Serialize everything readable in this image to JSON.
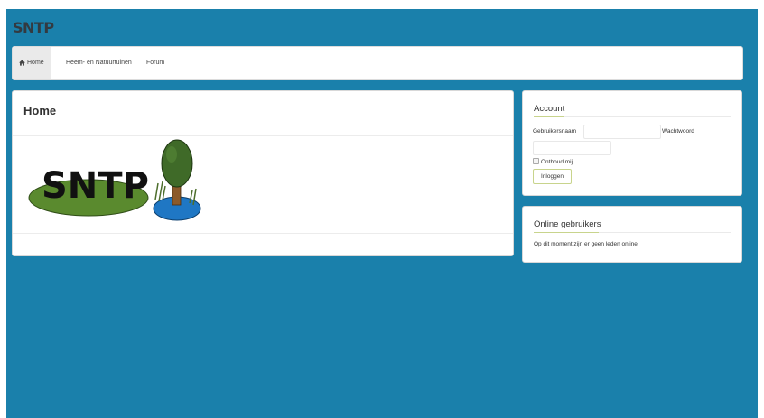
{
  "site": {
    "title": "SNTP"
  },
  "nav": {
    "items": [
      {
        "label": "Home",
        "icon": "home-icon",
        "active": true
      },
      {
        "label": "Heem- en Natuurtuinen",
        "active": false
      },
      {
        "label": "Forum",
        "active": false
      }
    ]
  },
  "main": {
    "title": "Home",
    "logo_text": "SNTP"
  },
  "account": {
    "title": "Account",
    "username_label": "Gebruikersnaam",
    "username_value": "",
    "password_label": "Wachtwoord",
    "password_value": "",
    "remember_label": "Onthoud mij",
    "login_button": "Inloggen"
  },
  "online": {
    "title": "Online gebruikers",
    "text": "Op dit moment zijn er geen leden online"
  },
  "colors": {
    "page_background": "#1a80ab",
    "accent_underline": "#c8d48c",
    "logo_green": "#5a8a2e",
    "logo_water": "#1f77c4",
    "logo_tree": "#3f6a28"
  }
}
